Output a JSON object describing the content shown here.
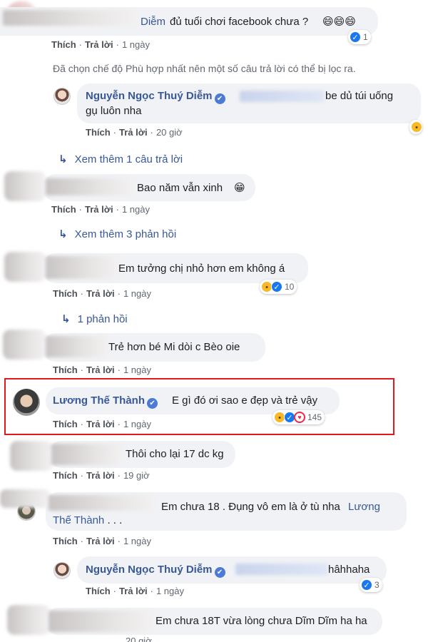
{
  "comments": [
    {
      "id": "c1",
      "text_suffix": "Diễm",
      "text": " đủ tuổi chơi facebook chưa ? ",
      "emoji": "😄😄😄",
      "actions": {
        "like": "Thích",
        "reply": "Trả lời",
        "time": "1 ngày"
      },
      "reactions": {
        "count": "1"
      }
    },
    {
      "id": "filter-note",
      "text": "Đã chọn chế độ Phù hợp nhất nên một số câu trả lời có thể bị lọc ra."
    },
    {
      "id": "r1",
      "author": "Nguyễn Ngọc Thuý Diễm",
      "text_line1": "be dủ túi uống",
      "text_line2": "gụ luôn nha",
      "actions": {
        "like": "Thích",
        "reply": "Trả lời",
        "time": "20 giờ"
      }
    },
    {
      "id": "more1",
      "text": "Xem thêm 1 câu trả lời"
    },
    {
      "id": "c2",
      "text": "Bao năm vẫn xinh ",
      "emoji": "😁",
      "actions": {
        "like": "Thích",
        "reply": "Trả lời",
        "time": "1 ngày"
      }
    },
    {
      "id": "more2",
      "text": "Xem thêm 3 phản hồi"
    },
    {
      "id": "c3",
      "text": "Em tưởng chị nhỏ hơn em không á",
      "actions": {
        "like": "Thích",
        "reply": "Trả lời",
        "time": "1 ngày"
      },
      "reactions": {
        "count": "10"
      }
    },
    {
      "id": "more3",
      "text": "1 phản hồi"
    },
    {
      "id": "c4",
      "text": "Trẻ hơn bé Mi dòi c Bèo oie",
      "actions": {
        "like": "Thích",
        "reply": "Trả lời",
        "time": "1 ngày"
      }
    },
    {
      "id": "c5",
      "author": "Lương Thế Thành",
      "text": "E gì đó ơi sao e đẹp và trẻ vậy",
      "actions": {
        "like": "Thích",
        "reply": "Trả lời",
        "time": "1 ngày"
      },
      "reactions": {
        "count": "145"
      }
    },
    {
      "id": "c6",
      "text": "Thôi cho lại 17 dc kg",
      "actions": {
        "like": "Thích",
        "reply": "Trả lời",
        "time": "19 giờ"
      }
    },
    {
      "id": "c7",
      "text": "Em chưa 18 . Đụng vô em là ở tù nha",
      "mention_1": "Lương",
      "mention_2": "Thế Thành",
      "text_end": " . . .",
      "actions": {
        "like": "Thích",
        "reply": "Trả lời",
        "time": "1 ngày"
      }
    },
    {
      "id": "r2",
      "author": "Nguyễn Ngọc Thuý Diễm",
      "text": "hâhhaha",
      "actions": {
        "like": "Thích",
        "reply": "Trả lời",
        "time": "1 ngày"
      },
      "reactions": {
        "count": "3"
      }
    },
    {
      "id": "c8",
      "text": "Em chưa 18T vừa lòng chưa Dĩm Dĩm ha ha",
      "actions": {
        "time": "20 giờ"
      }
    }
  ],
  "colors": {
    "link": "#385898",
    "bubble": "#f0f2f5",
    "highlight": "#e0191f",
    "like": "#1877f2",
    "haha": "#f7b928",
    "love": "#f02849"
  },
  "icons": {
    "verified": "✔",
    "reply_arrow": "↳",
    "like": "👍",
    "haha": "😆",
    "love": "♥"
  }
}
